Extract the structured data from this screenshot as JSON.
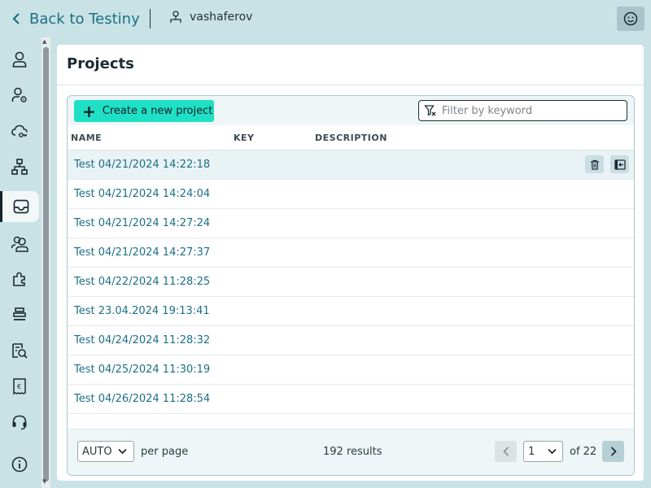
{
  "header": {
    "back_label": "Back to Testiny",
    "username": "vashaferov",
    "icons": {
      "back": "chevron-left-icon",
      "user": "user-network-icon",
      "profile": "smiley-icon"
    }
  },
  "sidebar": {
    "items": [
      {
        "icon": "user-icon",
        "active": false
      },
      {
        "icon": "user-settings-icon",
        "active": false
      },
      {
        "icon": "cloud-key-icon",
        "active": false
      },
      {
        "icon": "hierarchy-icon",
        "active": false
      },
      {
        "icon": "inbox-icon",
        "active": true
      },
      {
        "icon": "users-group-icon",
        "active": false
      },
      {
        "icon": "puzzle-icon",
        "active": false
      },
      {
        "icon": "stack-icon",
        "active": false
      },
      {
        "icon": "search-report-icon",
        "active": false
      },
      {
        "icon": "invoice-icon",
        "active": false
      },
      {
        "icon": "headset-icon",
        "active": false
      },
      {
        "icon": "info-icon",
        "active": false
      }
    ]
  },
  "main": {
    "title": "Projects",
    "create_label": "Create a new project",
    "filter_placeholder": "Filter by keyword",
    "columns": [
      "NAME",
      "KEY",
      "DESCRIPTION"
    ],
    "projects": [
      "Test 04/21/2024 14:22:18",
      "Test 04/21/2024 14:24:04",
      "Test 04/21/2024 14:27:24",
      "Test 04/21/2024 14:27:37",
      "Test 04/22/2024 11:28:25",
      "Test 23.04.2024 19:13:41",
      "Test 04/24/2024 11:28:32",
      "Test 04/25/2024 11:30:19",
      "Test 04/26/2024 11:28:54"
    ],
    "pagination": {
      "per_page_value": "AUTO",
      "per_page_label": "per page",
      "results": "192 results",
      "current_page": "1",
      "of_label": "of 22"
    }
  },
  "colors": {
    "accent": "#1fe0c4",
    "link": "#1b6f86",
    "background": "#c9e2e6"
  }
}
